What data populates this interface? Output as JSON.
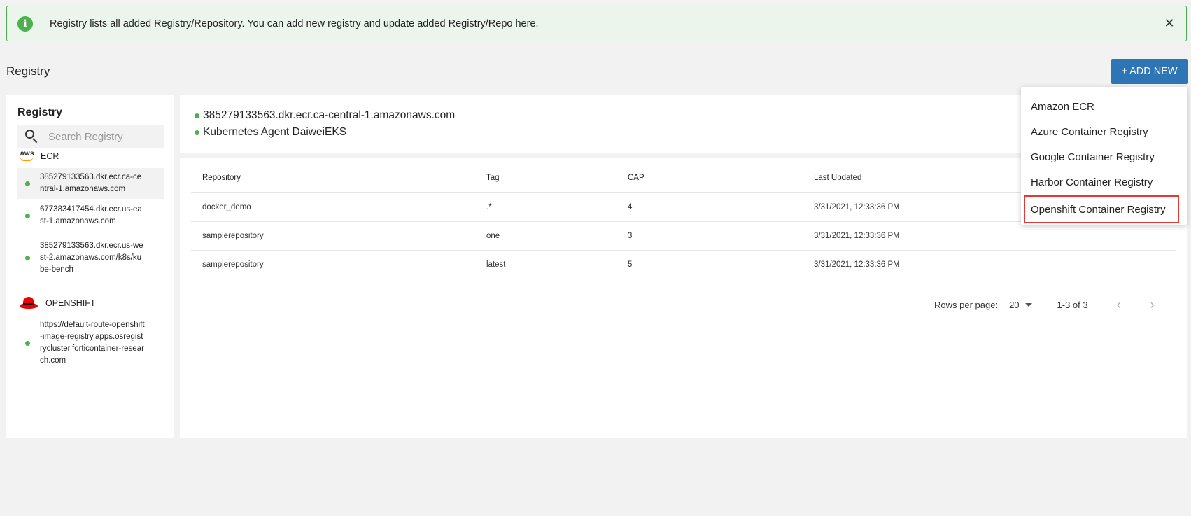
{
  "banner": {
    "text": "Registry lists all added Registry/Repository. You can add new registry and update added Registry/Repo here.",
    "info_glyph": "i",
    "close_glyph": "✕"
  },
  "page": {
    "title": "Registry",
    "add_button_label": "+ ADD NEW"
  },
  "sidebar": {
    "title": "Registry",
    "search_placeholder": "Search Registry",
    "groups": [
      {
        "label": "ECR",
        "logo_text": "aws",
        "items": [
          "385279133563.dkr.ecr.ca-central-1.amazonaws.com",
          "677383417454.dkr.ecr.us-east-1.amazonaws.com",
          "385279133563.dkr.ecr.us-west-2.amazonaws.com/k8s/kube-bench"
        ]
      },
      {
        "label": "OPENSHIFT",
        "items": [
          "https://default-route-openshift-image-registry.apps.osregistrycluster.forticontainer-research.com"
        ]
      }
    ]
  },
  "details": {
    "registry_url": "385279133563.dkr.ecr.ca-central-1.amazonaws.com",
    "agent": "Kubernetes Agent DaiweiEKS"
  },
  "table": {
    "headers": [
      "Repository",
      "Tag",
      "CAP",
      "Last Updated"
    ],
    "rows": [
      [
        "docker_demo",
        ".*",
        "4",
        "3/31/2021, 12:33:36 PM"
      ],
      [
        "samplerepository",
        "one",
        "3",
        "3/31/2021, 12:33:36 PM"
      ],
      [
        "samplerepository",
        "latest",
        "5",
        "3/31/2021, 12:33:36 PM"
      ]
    ]
  },
  "pagination": {
    "rows_per_page_label": "Rows per page:",
    "rows_per_page_value": "20",
    "range": "1-3 of 3",
    "prev_glyph": "‹",
    "next_glyph": "›"
  },
  "dropdown": {
    "items": [
      "Amazon ECR",
      "Azure Container Registry",
      "Google Container Registry",
      "Harbor Container Registry",
      "Openshift Container Registry"
    ],
    "highlighted_index": 4
  },
  "colors": {
    "accent": "#2e75b6",
    "status_green": "#4caf50",
    "banner_bg": "#ecf5ec",
    "highlight_outline": "#e53935"
  }
}
